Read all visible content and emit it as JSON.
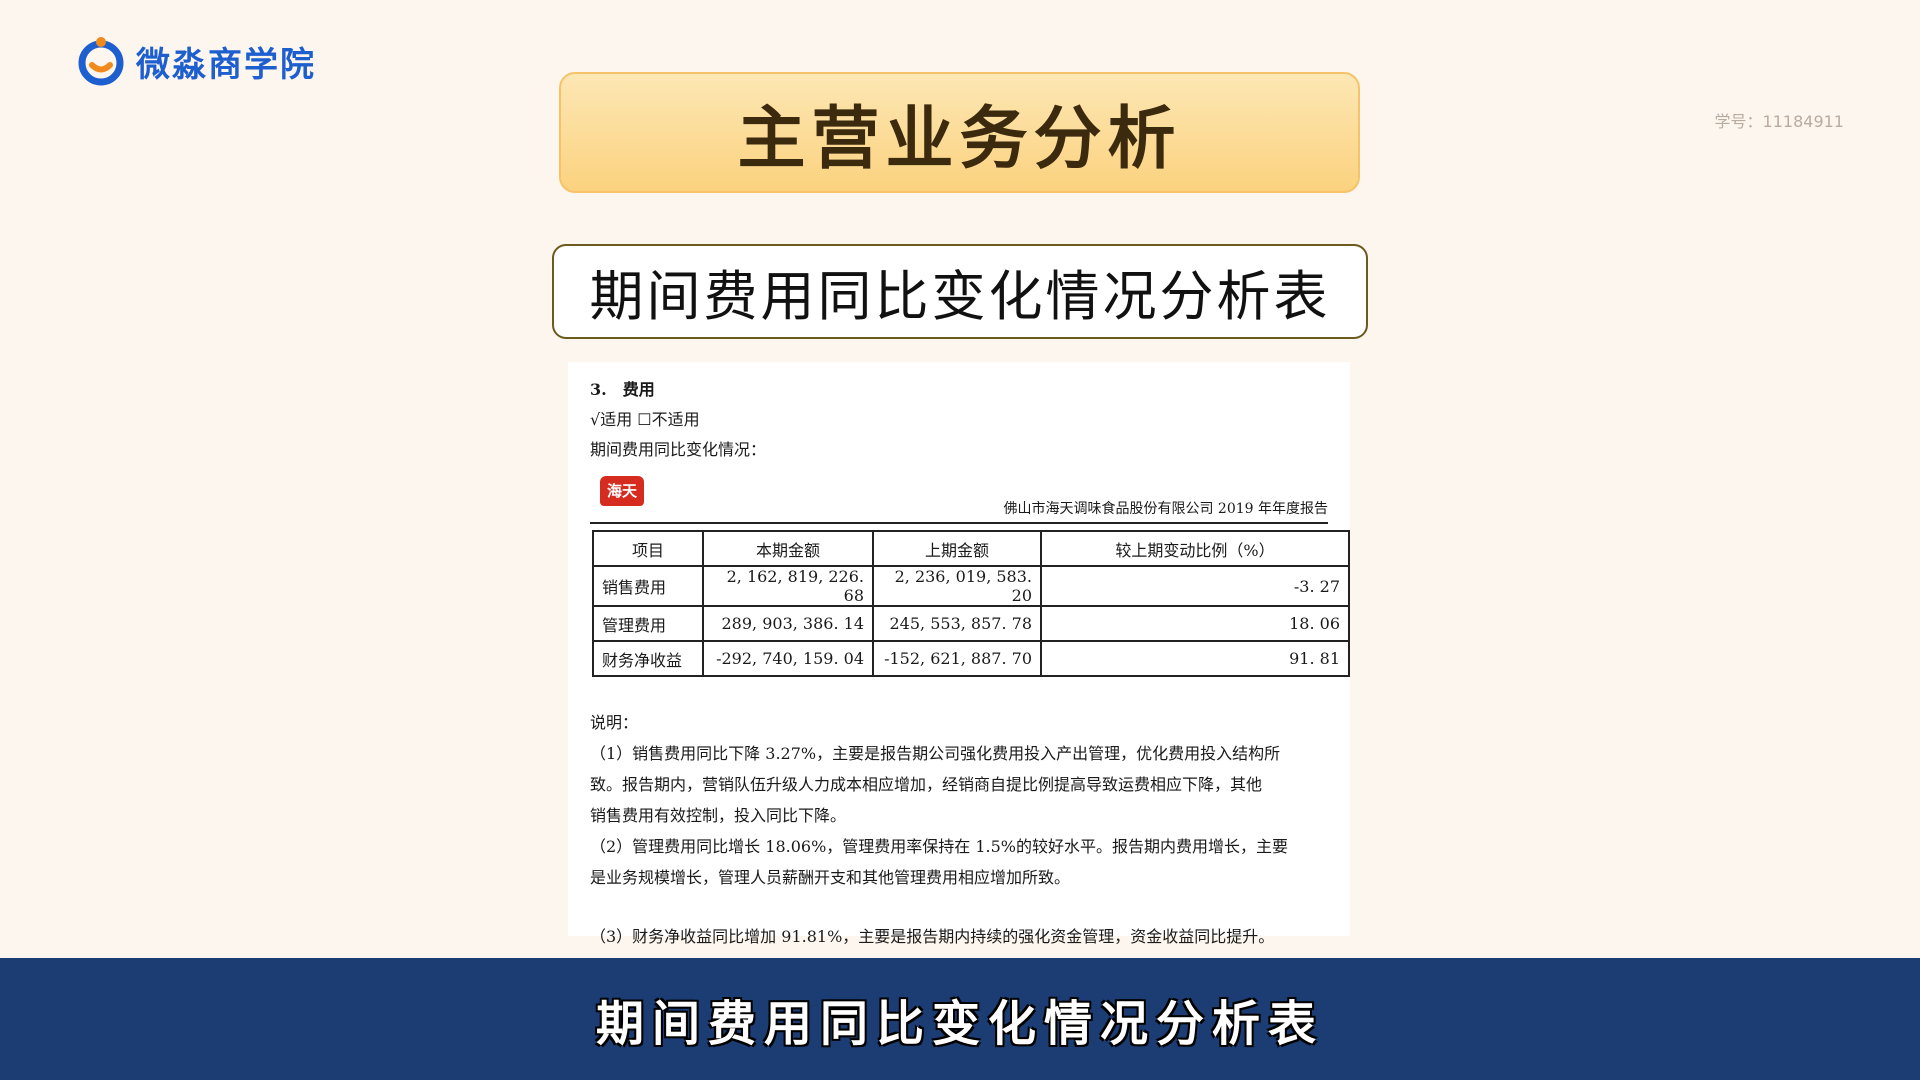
{
  "logo": {
    "text": "微淼商学院",
    "icon": "smile-ring-icon"
  },
  "student_id": "学号：11184911",
  "title": "主营业务分析",
  "subtitle": "期间费用同比变化情况分析表",
  "document": {
    "section": "3.　费用",
    "applicability": "√适用 ☐不适用",
    "intro": "期间费用同比变化情况：",
    "brand": "海天",
    "report_title": "佛山市海天调味食品股份有限公司 2019 年年度报告",
    "table": {
      "headers": [
        "项目",
        "本期金额",
        "上期金额",
        "较上期变动比例（%）"
      ],
      "rows": [
        [
          "销售费用",
          "2, 162, 819, 226. 68",
          "2, 236, 019, 583. 20",
          "-3. 27"
        ],
        [
          "管理费用",
          "289, 903, 386. 14",
          "245, 553, 857. 78",
          "18. 06"
        ],
        [
          "财务净收益",
          "-292, 740, 159. 04",
          "-152, 621, 887. 70",
          "91. 81"
        ]
      ]
    },
    "notes_title": "说明：",
    "notes": [
      "（1）销售费用同比下降 3.27%，主要是报告期公司强化费用投入产出管理，优化费用投入结构所",
      "致。报告期内，营销队伍升级人力成本相应增加，经销商自提比例提高导致运费相应下降，其他",
      "销售费用有效控制，投入同比下降。",
      "（2）管理费用同比增长 18.06%，管理费用率保持在 1.5%的较好水平。报告期内费用增长，主要",
      "是业务规模增长，管理人员薪酬开支和其他管理费用相应增加所致。",
      "（3）财务净收益同比增加 91.81%，主要是报告期内持续的强化资金管理，资金收益同比提升。"
    ]
  },
  "caption": "期间费用同比变化情况分析表",
  "colors": {
    "caption_bar": "#1b3d73",
    "banner": "#fbd27f",
    "logo": "#1e5fd0",
    "accent_orange": "#f08a1c"
  }
}
